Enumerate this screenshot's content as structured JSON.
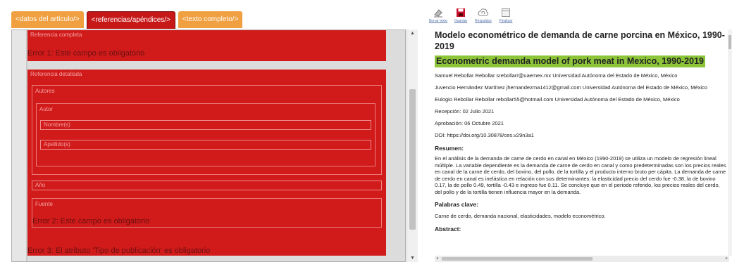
{
  "tabs": [
    {
      "label": "<datos del artículo/>"
    },
    {
      "label": "<referencias/apéndices/>"
    },
    {
      "label": "<texto completo/>"
    }
  ],
  "form": {
    "referencia_completa_label": "Referencia completa",
    "error1": "Error 1: Este campo es obligatorio",
    "referencia_detallada_label": "Referencia detallada",
    "autores_label": "Autores",
    "autor_label": "Autor",
    "nombres_placeholder": "Nombre(s)",
    "apellidos_placeholder": "Apellido(s)",
    "anio_label": "Año",
    "fuente_label": "Fuente",
    "error2": "Error 2: Este campo es obligatorio",
    "error3": "Error 3: El atributo 'Tipo de publicación' es obligatorio"
  },
  "toolbar": {
    "borrar": "Borrar texto",
    "guardar": "Guardar",
    "respaldos": "Respaldos",
    "finalizar": "Finalizar"
  },
  "article": {
    "title_es": "Modelo econométrico de demanda de carne porcina en México, 1990-2019",
    "title_en": "Econometric demanda model of pork meat in Mexico, 1990-2019",
    "author1": "Samuel Rebollar Rebollar srebollarr@uaemex.mx Universidad Autónoma del Estado de México, México",
    "author2": "Juvencio Hernández Martínez jhernandezma1412@gmail.com Universidad Autónoma del Estado de México, México",
    "author3": "Eulogio Rebollar Rebollar rebollar55@hotmail.com Universidad Autónoma del Estado de México, México",
    "recepcion": "Recepción: 02 Julio 2021",
    "aprobacion": "Aprobación: 06 Octubre 2021",
    "doi": "DOI: https://doi.org/10.30878/ces.v29n3a1",
    "resumen_heading": "Resumen:",
    "resumen": "En el análisis de la demanda de carne de cerdo en canal en México (1990-2019) se utiliza un modelo de regresión lineal múltiple. La variable dependiente es la demanda de carne de cerdo en canal y como predeterminadas son los precios reales en canal de la carne de cerdo, del bovino, del pollo, de la tortilla y el producto interno bruto per cápita. La demanda de carne de cerdo en canal es inelástica en relación con sus determinantes: la elasticidad precio del cerdo fue -0.38, la de bovino 0.17, la de pollo 0.49, tortilla -0.43 e ingreso fue 0.11. Se concluye que en el periodo referido, los precios reales del cerdo, del pollo y de la tortilla tienen influencia mayor en la demanda.",
    "palabras_heading": "Palabras clave:",
    "palabras": "Carne de cerdo, demanda nacional, elasticidades, modelo econométrico.",
    "abstract_heading": "Abstract:"
  },
  "colors": {
    "tab_orange": "#f0a040",
    "tab_active": "#c71818",
    "error_red": "#d11b1b",
    "highlight_green": "#8cc43a"
  }
}
